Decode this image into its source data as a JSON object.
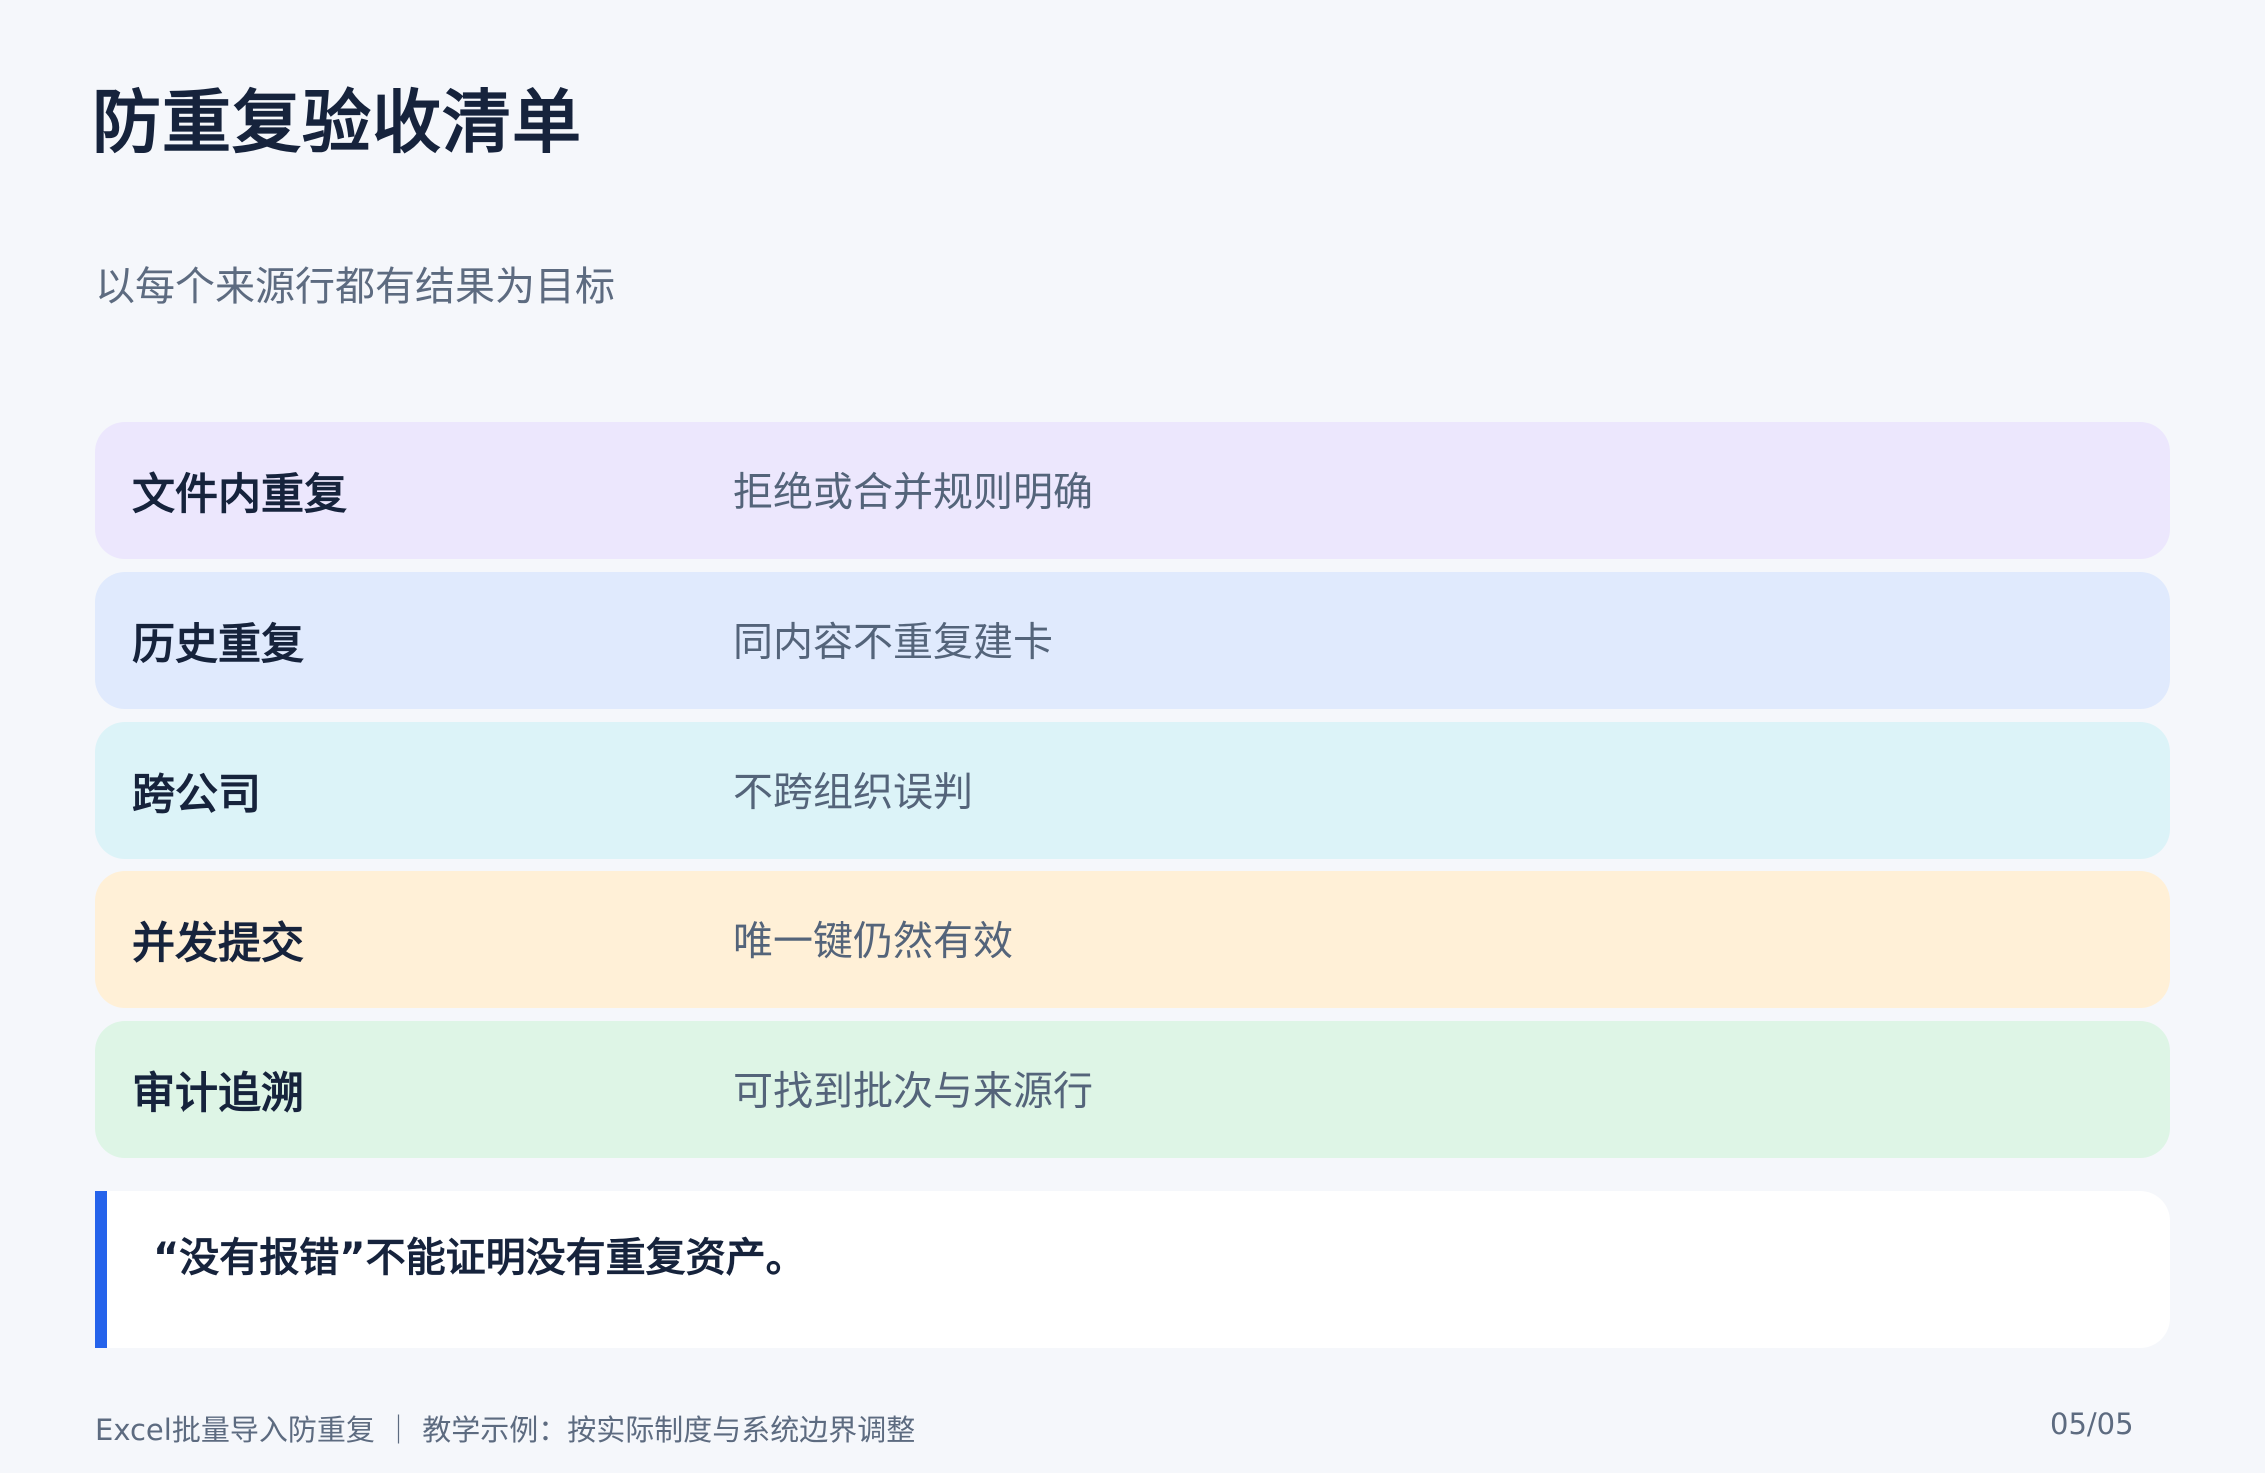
{
  "title": "防重复验收清单",
  "subtitle": "以每个来源行都有结果为目标",
  "rows": [
    {
      "label": "文件内重复",
      "value": "拒绝或合并规则明确",
      "color": "#ece7fd"
    },
    {
      "label": "历史重复",
      "value": "同内容不重复建卡",
      "color": "#e0eafd"
    },
    {
      "label": "跨公司",
      "value": "不跨组织误判",
      "color": "#dcf3f8"
    },
    {
      "label": "并发提交",
      "value": "唯一键仍然有效",
      "color": "#fff0d7"
    },
    {
      "label": "审计追溯",
      "value": "可找到批次与来源行",
      "color": "#def5e6"
    }
  ],
  "note": "“没有报错”不能证明没有重复资产。",
  "accent_color": "#2563eb",
  "footer": {
    "left": "Excel批量导入防重复 ｜ 教学示例：按实际制度与系统边界调整",
    "page": "05/05"
  }
}
